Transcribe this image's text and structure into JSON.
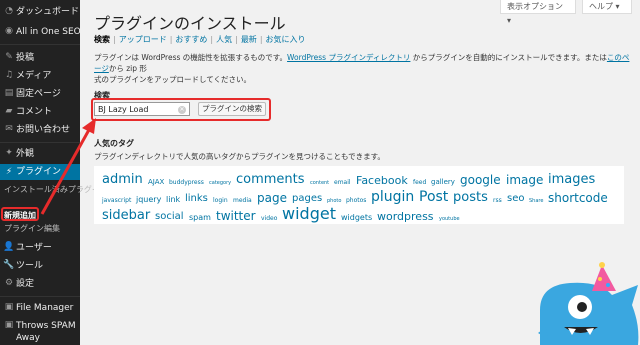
{
  "sidebar": {
    "items": [
      {
        "icon": "dashboard-icon",
        "label": "ダッシュボード"
      },
      {
        "icon": "seo-icon",
        "label": "All in One SEO"
      },
      {
        "icon": "pin-icon",
        "label": "投稿"
      },
      {
        "icon": "media-icon",
        "label": "メディア"
      },
      {
        "icon": "page-icon",
        "label": "固定ページ"
      },
      {
        "icon": "comment-icon",
        "label": "コメント"
      },
      {
        "icon": "contact-icon",
        "label": "お問い合わせ"
      },
      {
        "icon": "appearance-icon",
        "label": "外観"
      },
      {
        "icon": "plugin-icon",
        "label": "プラグイン"
      },
      {
        "icon": "user-icon",
        "label": "ユーザー"
      },
      {
        "icon": "tool-icon",
        "label": "ツール"
      },
      {
        "icon": "settings-icon",
        "label": "設定"
      },
      {
        "icon": "file-manager-icon",
        "label": "File Manager"
      },
      {
        "icon": "spam-icon",
        "label": "Throws SPAM Away"
      }
    ],
    "plugin_submenu": [
      "インストール済みプラグイン",
      "新規追加",
      "プラグイン編集"
    ]
  },
  "header": {
    "screen_options": "表示オプション ▾",
    "help": "ヘルプ ▾"
  },
  "main": {
    "title": "プラグインのインストール",
    "filters": [
      "検索",
      "アップロード",
      "おすすめ",
      "人気",
      "最新",
      "お気に入り"
    ],
    "desc_line1_a": "プラグインは WordPress の機能性を拡張するものです。",
    "desc_link1": "WordPress プラグインディレクトリ",
    "desc_line1_b": " からプラグインを自動的にインストールできます。または",
    "desc_link2": "このページ",
    "desc_line1_c": "から zip 形",
    "desc_line2": "式のプラグインをアップロードしてください。",
    "search_label": "検索",
    "search_value": "BJ Lazy Load",
    "search_button": "プラグインの検索",
    "popular_label": "人気のタグ",
    "popular_desc": "プラグインディレクトリで人気の高いタグからプラグインを見つけることもできます。"
  },
  "tags": [
    {
      "t": "admin",
      "s": 13
    },
    {
      "t": "AJAX",
      "s": 7
    },
    {
      "t": "buddypress",
      "s": 6
    },
    {
      "t": "category",
      "s": 5
    },
    {
      "t": "comments",
      "s": 13
    },
    {
      "t": "content",
      "s": 5
    },
    {
      "t": "email",
      "s": 6
    },
    {
      "t": "Facebook",
      "s": 11
    },
    {
      "t": "feed",
      "s": 6
    },
    {
      "t": "gallery",
      "s": 7
    },
    {
      "t": "google",
      "s": 12
    },
    {
      "t": "image",
      "s": 12
    },
    {
      "t": "images",
      "s": 13
    },
    {
      "t": "javascript",
      "s": 6
    },
    {
      "t": "jquery",
      "s": 8
    },
    {
      "t": "link",
      "s": 8
    },
    {
      "t": "links",
      "s": 10
    },
    {
      "t": "login",
      "s": 6
    },
    {
      "t": "media",
      "s": 6
    },
    {
      "t": "page",
      "s": 12
    },
    {
      "t": "pages",
      "s": 10
    },
    {
      "t": "photo",
      "s": 5
    },
    {
      "t": "photos",
      "s": 6
    },
    {
      "t": "plugin",
      "s": 14
    },
    {
      "t": "Post",
      "s": 14
    },
    {
      "t": "posts",
      "s": 13
    },
    {
      "t": "rss",
      "s": 6
    },
    {
      "t": "seo",
      "s": 10
    },
    {
      "t": "Share",
      "s": 5
    },
    {
      "t": "shortcode",
      "s": 12
    },
    {
      "t": "sidebar",
      "s": 13
    },
    {
      "t": "social",
      "s": 10
    },
    {
      "t": "spam",
      "s": 8
    },
    {
      "t": "twitter",
      "s": 12
    },
    {
      "t": "video",
      "s": 6
    },
    {
      "t": "widget",
      "s": 16
    },
    {
      "t": "widgets",
      "s": 8
    },
    {
      "t": "wordpress",
      "s": 11
    },
    {
      "t": "youtube",
      "s": 5
    }
  ],
  "colors": {
    "accent": "#0074a2",
    "highlight": "#e62b2b",
    "sidebar": "#222222"
  }
}
